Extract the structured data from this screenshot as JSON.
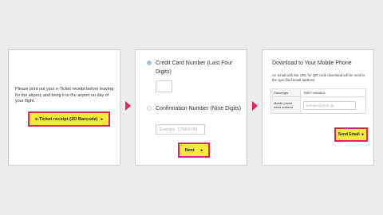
{
  "step1": {
    "instructions": "Please print out your e-Ticket receipt before leaving for the airport, and bring it to the airport on day of your flight.",
    "button_label": "e-Ticket receipt (2D Barcode)"
  },
  "step2": {
    "option1_label": "Credit Card Number (Last Four Digits)",
    "option1_selected": true,
    "option2_label": "Confirmation Number (Nine Digits)",
    "option2_selected": false,
    "confirmation_placeholder": "Example: 123456789",
    "next_label": "Next"
  },
  "step3": {
    "title": "Download to Your Mobile Phone",
    "description": "An email with the URL for QR code download will be sent to the specified email address.",
    "rows": [
      {
        "label": "Passenger",
        "value": "TARO YAMADA"
      },
      {
        "label": "Mobile phone email address",
        "value": ""
      }
    ],
    "email_placeholder": "sample@ando.jp",
    "send_label": "Send Email"
  },
  "colors": {
    "highlight_fill": "#f5ea3c",
    "highlight_border": "#e0245e",
    "arrow": "#e0245e"
  },
  "icons": {
    "step_arrow": "triangle-right-icon",
    "button_caret": "caret-right-icon"
  }
}
